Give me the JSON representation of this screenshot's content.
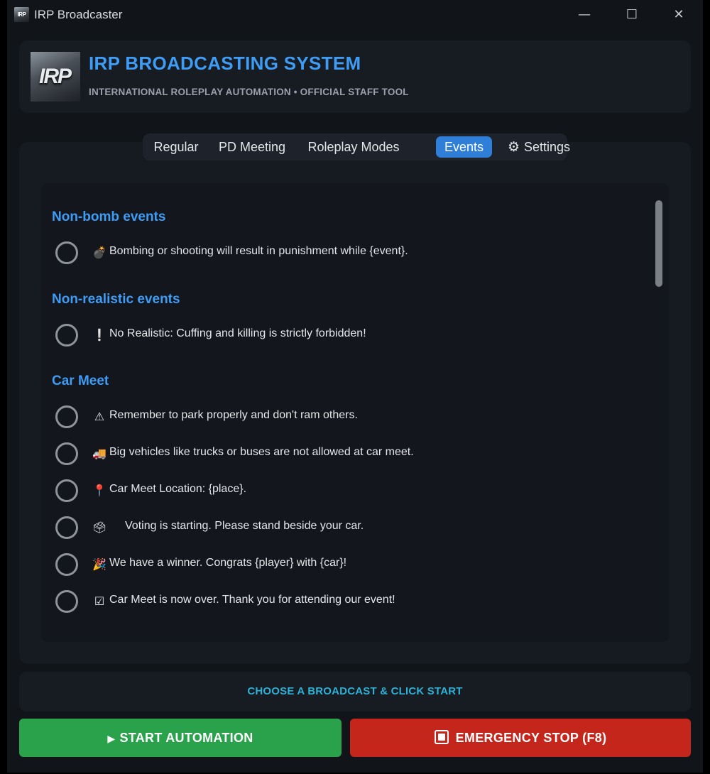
{
  "window": {
    "title": "IRP Broadcaster",
    "logo_text": "IRP",
    "controls": {
      "minimize": "—",
      "maximize": "☐",
      "close": "✕"
    }
  },
  "header": {
    "logo_text": "IRP",
    "title": "IRP BROADCASTING SYSTEM",
    "subtitle": "INTERNATIONAL ROLEPLAY AUTOMATION • OFFICIAL STAFF TOOL"
  },
  "tabs": [
    {
      "label": "Regular",
      "active": false
    },
    {
      "label": "PD Meeting",
      "active": false
    },
    {
      "label": "Roleplay Modes",
      "active": false
    },
    {
      "label": "Events",
      "active": true
    },
    {
      "label": "Settings",
      "active": false,
      "icon": "gear-icon",
      "glyph": "⚙"
    }
  ],
  "sections": [
    {
      "title": "Non-bomb events",
      "items": [
        {
          "icon": "bomb-icon",
          "glyph": "💣",
          "text": "Bombing or shooting will result in punishment while {event}."
        }
      ]
    },
    {
      "title": "Non-realistic events",
      "items": [
        {
          "icon": "exclamation-icon",
          "glyph": "❕",
          "text": "No Realistic: Cuffing and killing is strictly forbidden!"
        }
      ]
    },
    {
      "title": "Car Meet",
      "items": [
        {
          "icon": "warning-icon",
          "glyph": "⚠",
          "text": "Remember to park properly and don't ram others."
        },
        {
          "icon": "truck-icon",
          "glyph": "🚚",
          "text": "Big vehicles like trucks or buses are not allowed at car meet."
        },
        {
          "icon": "pin-icon",
          "glyph": "📍",
          "text": "Car Meet Location: {place}."
        },
        {
          "icon": "ballot-box-icon",
          "glyph": "🗳",
          "text": "Voting is starting. Please stand beside your car."
        },
        {
          "icon": "party-popper-icon",
          "glyph": "🎉",
          "text": "We have a winner. Congrats {player} with {car}!"
        },
        {
          "icon": "check-box-icon",
          "glyph": "☑",
          "text": "Car Meet is now over. Thank you for attending our event!"
        }
      ]
    }
  ],
  "status": {
    "text": "CHOOSE A BROADCAST & CLICK START"
  },
  "buttons": {
    "start": {
      "glyph": "▶",
      "label": "START AUTOMATION"
    },
    "stop": {
      "label": "EMERGENCY STOP (F8)"
    }
  },
  "colors": {
    "accent": "#3f9cf5",
    "active_tab": "#2f7fd9",
    "status_text": "#2fb0d6",
    "start": "#2aa24c",
    "stop": "#c5261c"
  }
}
